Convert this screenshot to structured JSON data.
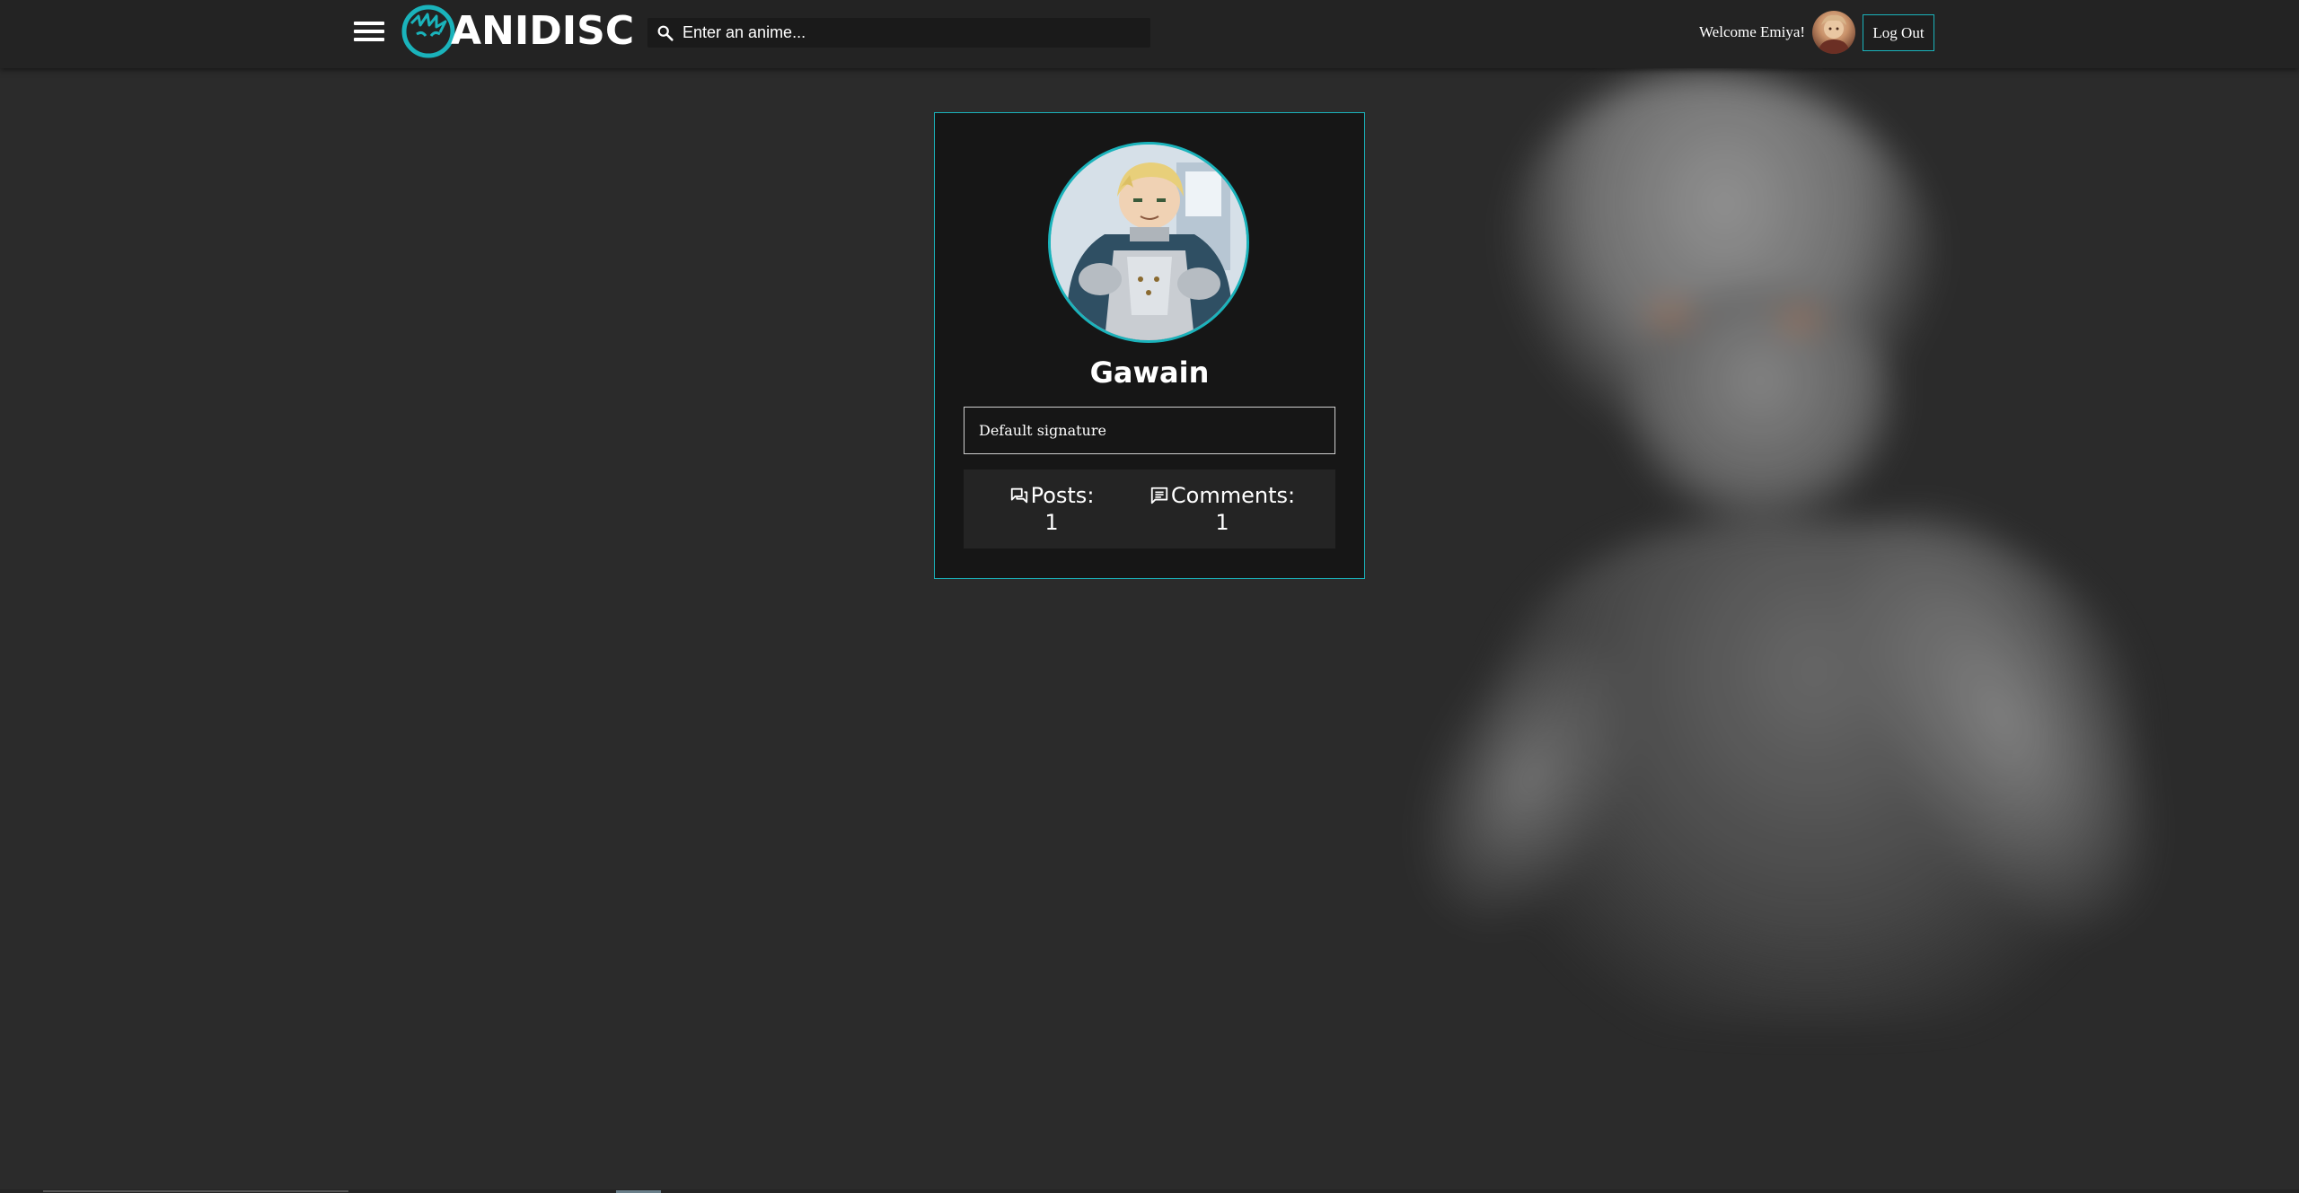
{
  "header": {
    "menu_icon": "hamburger-menu-icon",
    "logo": {
      "text": "ANIDISC",
      "icon": "anidisc-logo-icon",
      "accent_color": "#1ab3bb"
    },
    "search": {
      "placeholder": "Enter an anime...",
      "value": "",
      "icon": "search-icon"
    },
    "welcome_text": "Welcome Emiya!",
    "user_avatar": "user-avatar",
    "logout_label": "Log Out"
  },
  "profile": {
    "username": "Gawain",
    "signature": "Default signature",
    "stats": {
      "posts_label": "Posts:",
      "posts_value": "1",
      "posts_icon": "posts-icon",
      "comments_label": "Comments:",
      "comments_value": "1",
      "comments_icon": "comments-icon"
    }
  },
  "colors": {
    "accent": "#1ab3bb",
    "header_bg": "#232323",
    "page_bg": "#2b2b2b",
    "card_bg": "#161616"
  }
}
